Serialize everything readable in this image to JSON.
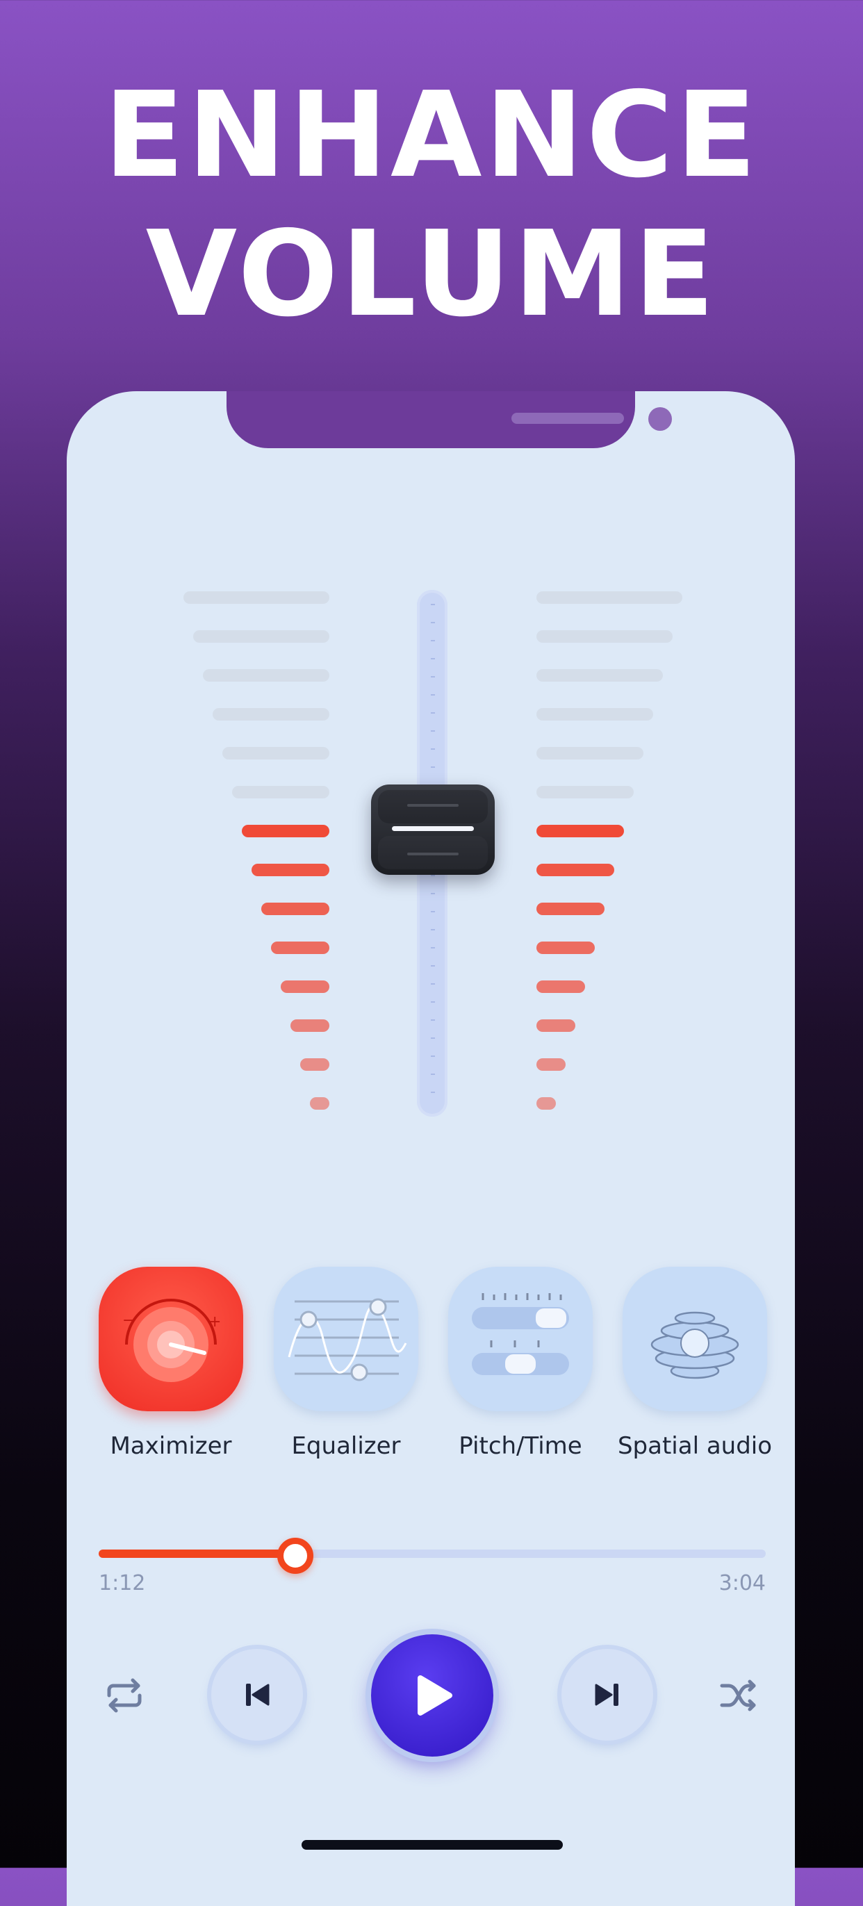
{
  "headline": {
    "line1": "ENHANCE",
    "line2": "VOLUME"
  },
  "meter": {
    "left_active": 8,
    "right_active": 8,
    "total_bars": 14,
    "active_color": "#f04a37",
    "inactive_color": "#d4dde9"
  },
  "features": [
    {
      "label": "Maximizer",
      "icon": "maximizer-dial-icon",
      "active": true
    },
    {
      "label": "Equalizer",
      "icon": "equalizer-curve-icon",
      "active": false
    },
    {
      "label": "Pitch/Time",
      "icon": "pitch-sliders-icon",
      "active": false
    },
    {
      "label": "Spatial audio",
      "icon": "spatial-rings-icon",
      "active": false
    }
  ],
  "player": {
    "elapsed": "1:12",
    "duration": "3:04",
    "progress": 0.295
  },
  "colors": {
    "accent": "#f2451d",
    "play": "#3d22d6",
    "background": "#dde9f7"
  }
}
